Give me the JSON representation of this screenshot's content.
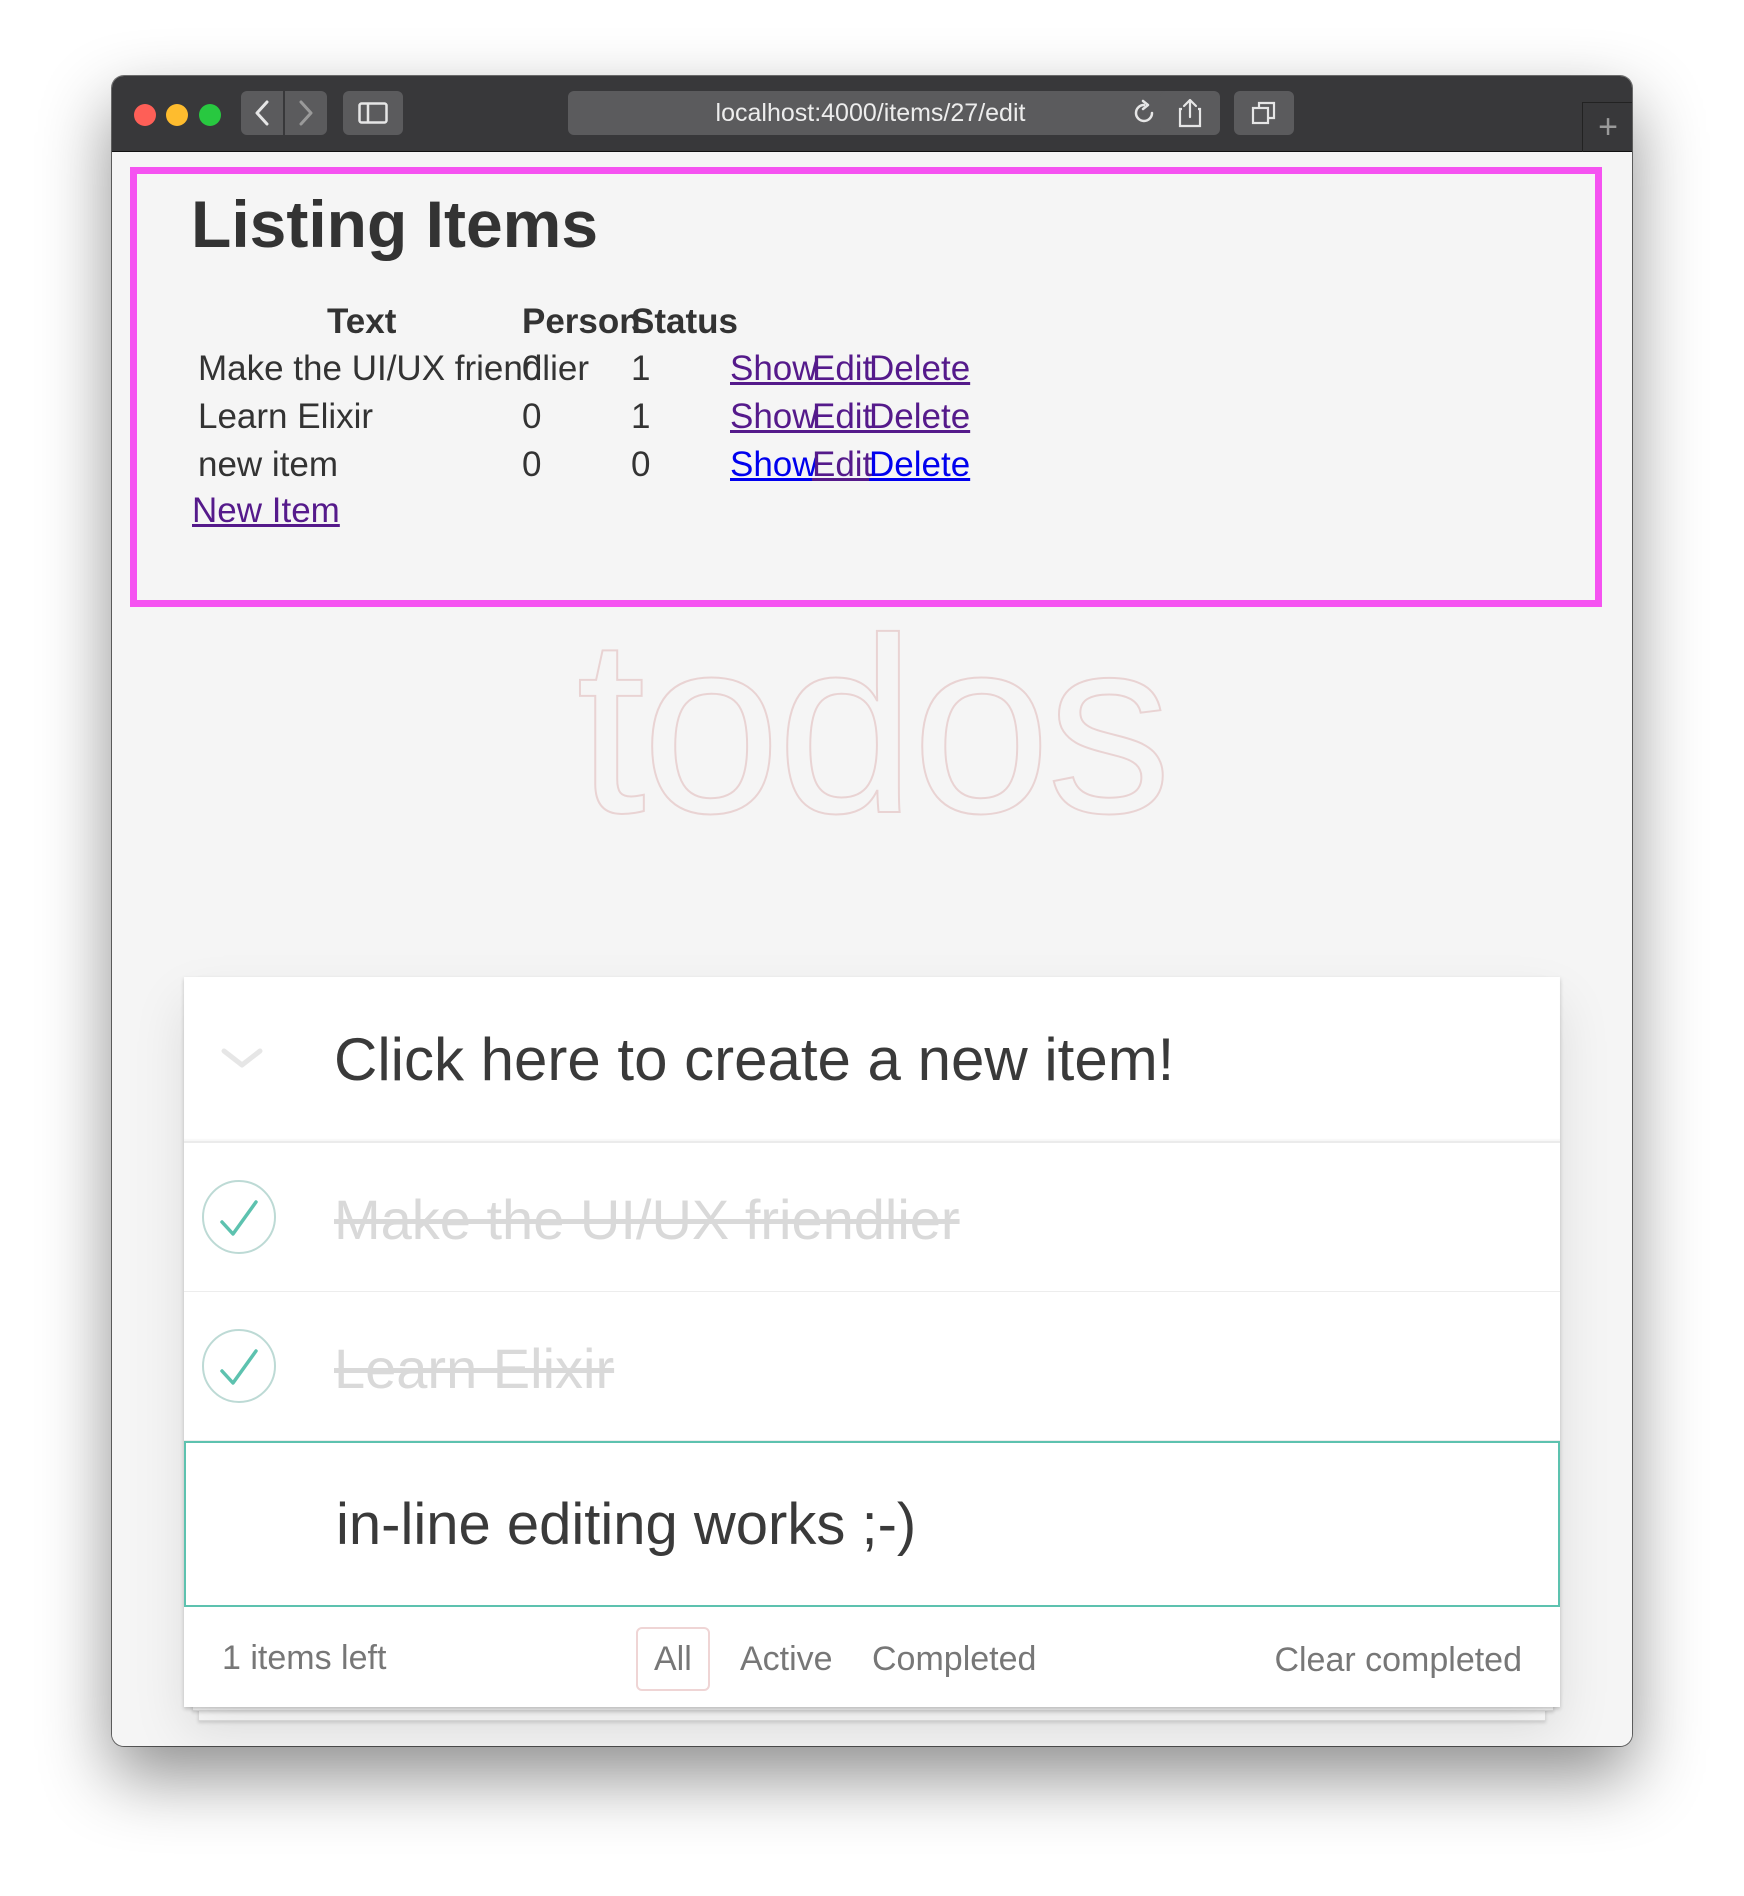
{
  "browser": {
    "url": "localhost:4000/items/27/edit"
  },
  "listing": {
    "title": "Listing Items",
    "headers": [
      "Text",
      "Person",
      "Status"
    ],
    "rows": [
      {
        "text": "Make the UI/UX friendlier",
        "person": "0",
        "status": "1"
      },
      {
        "text": "Learn Elixir",
        "person": "0",
        "status": "1"
      },
      {
        "text": "new item",
        "person": "0",
        "status": "0"
      }
    ],
    "actions": {
      "show": "Show",
      "edit": "Edit",
      "delete": "Delete"
    },
    "new_item_link": "New Item"
  },
  "todos": {
    "title": "todos",
    "new_todo_text": "Click here to create a new item!",
    "items": [
      {
        "label": "Make the UI/UX friendlier",
        "completed": true
      },
      {
        "label": "Learn Elixir",
        "completed": true
      }
    ],
    "editing_value": "in-line editing works ;-)",
    "footer": {
      "count": "1 items left",
      "filters": [
        "All",
        "Active",
        "Completed"
      ],
      "selected_filter": "All",
      "clear": "Clear completed"
    }
  },
  "colors": {
    "highlight_border": "#f553f1",
    "todo_accent": "#5dc2af",
    "link_visited": "#551a8b",
    "link_unvisited": "#0000ee"
  }
}
